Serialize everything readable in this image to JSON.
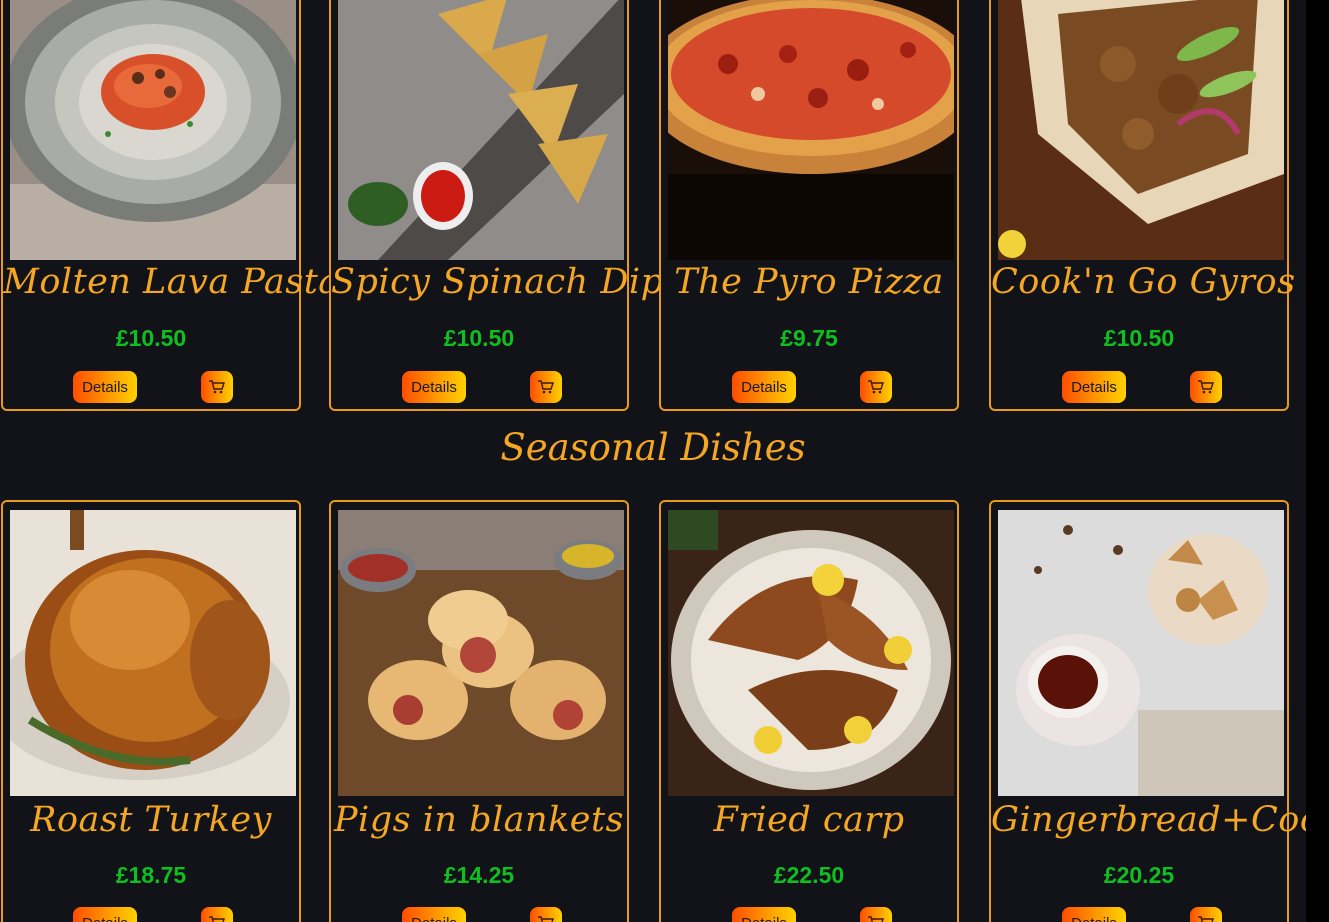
{
  "colors": {
    "background": "#111318",
    "accent": "#f5a623",
    "border": "#e89a1a",
    "price": "#0fbf1f"
  },
  "section_heading": "Seasonal Dishes",
  "buttons": {
    "details_label": "Details",
    "cart_icon": "cart-icon"
  },
  "row1": [
    {
      "name": "Molten Lava Pasta",
      "price": "£10.50"
    },
    {
      "name": "Spicy Spinach Dip",
      "price": "£10.50"
    },
    {
      "name": "The Pyro Pizza",
      "price": "£9.75"
    },
    {
      "name": "Cook'n Go Gyros",
      "price": "£10.50"
    }
  ],
  "row2": [
    {
      "name": "Roast Turkey",
      "price": "£18.75"
    },
    {
      "name": "Pigs in blankets",
      "price": "£14.25"
    },
    {
      "name": "Fried carp",
      "price": "£22.50"
    },
    {
      "name": "Gingerbread+Cocoa",
      "price": "£20.25"
    }
  ]
}
